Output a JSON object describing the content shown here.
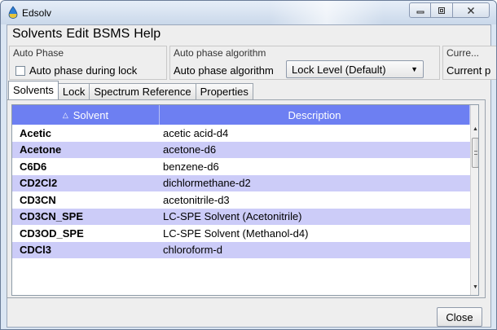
{
  "window": {
    "title": "Edsolv",
    "buttons": [
      "minimize",
      "maximize",
      "close"
    ]
  },
  "menubar": {
    "items": [
      "Solvents",
      "Edit",
      "BSMS",
      "Help"
    ]
  },
  "auto_phase_group": {
    "title": "Auto Phase",
    "checkbox_label": "Auto phase during lock",
    "checked": false
  },
  "algorithm_group": {
    "title": "Auto phase algorithm",
    "label": "Auto phase algorithm",
    "selected": "Lock Level (Default)"
  },
  "current_group": {
    "title": "Curre...",
    "label": "Current p"
  },
  "tabs": [
    {
      "label": "Solvents",
      "active": true
    },
    {
      "label": "Lock",
      "active": false
    },
    {
      "label": "Spectrum Reference",
      "active": false
    },
    {
      "label": "Properties",
      "active": false
    }
  ],
  "table": {
    "columns": [
      "Solvent",
      "Description"
    ],
    "sort_column": "Solvent",
    "header_color": "#6d7ff2",
    "alt_row_color": "#ccccf8",
    "rows": [
      [
        "Acetic",
        "acetic acid-d4"
      ],
      [
        "Acetone",
        "acetone-d6"
      ],
      [
        "C6D6",
        "benzene-d6"
      ],
      [
        "CD2Cl2",
        "dichlormethane-d2"
      ],
      [
        "CD3CN",
        "acetonitrile-d3"
      ],
      [
        "CD3CN_SPE",
        "LC-SPE Solvent (Acetonitrile)"
      ],
      [
        "CD3OD_SPE",
        "LC-SPE Solvent (Methanol-d4)"
      ],
      [
        "CDCl3",
        "chloroform-d"
      ]
    ]
  },
  "footer": {
    "close_label": "Close"
  }
}
